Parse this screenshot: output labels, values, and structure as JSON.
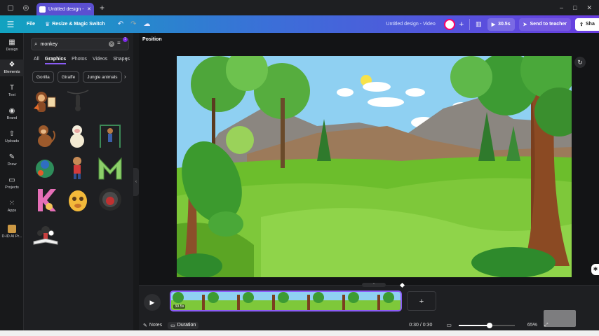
{
  "browser": {
    "tab_title": "Untitled design - V...",
    "new_tab": "+",
    "window_controls": [
      "–",
      "□",
      "✕"
    ]
  },
  "toolbar": {
    "menu_icon": "menu-icon",
    "file_label": "File",
    "resize_label": "Resize & Magic Switch",
    "design_title": "Untitled design - Video",
    "duration_label": "30.5s",
    "send_label": "Send to teacher",
    "share_label": "Sha"
  },
  "rail": {
    "items": [
      {
        "label": "Design",
        "icon": "design-icon"
      },
      {
        "label": "Elements",
        "icon": "elements-icon"
      },
      {
        "label": "Text",
        "icon": "text-icon"
      },
      {
        "label": "Brand",
        "icon": "brand-icon"
      },
      {
        "label": "Uploads",
        "icon": "uploads-icon"
      },
      {
        "label": "Draw",
        "icon": "draw-icon"
      },
      {
        "label": "Projects",
        "icon": "projects-icon"
      },
      {
        "label": "Apps",
        "icon": "apps-icon"
      },
      {
        "label": "D-ID AI Pr...",
        "icon": "d-id-app-icon"
      }
    ],
    "active": "Elements"
  },
  "panel": {
    "search_value": "monkey",
    "filter_badge": "1",
    "tabs": [
      "All",
      "Graphics",
      "Photos",
      "Videos",
      "Shapes"
    ],
    "active_tab": "Graphics",
    "chips": [
      "Gorilla",
      "Giraffe",
      "Jungle animals"
    ],
    "graphics": [
      "monkey-with-sign",
      "hanging-monkey",
      "sitting-monkey",
      "white-monkey",
      "monkey-on-bars",
      "monkey-on-ball",
      "monkey-in-red",
      "letter-m-monkey",
      "letter-k-monkey",
      "yellow-monkey-mask",
      "gorilla-face",
      "monkey-on-book"
    ]
  },
  "stage": {
    "position_label": "Position"
  },
  "timeline": {
    "clip_duration": "30.5s",
    "add_label": "+"
  },
  "bottombar": {
    "notes_label": "Notes",
    "duration_label": "Duration",
    "time": "0:30 / 0:30",
    "zoom": "65%",
    "zoom_fraction": 0.55
  },
  "colors": {
    "accent": "#8b5cf6",
    "sky": "#8fd0f2",
    "grass": "#7ec83a"
  }
}
